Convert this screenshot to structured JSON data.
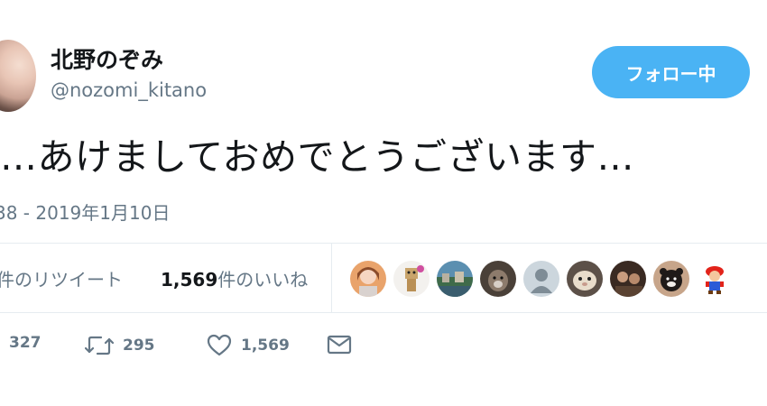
{
  "user": {
    "display_name": "北野のぞみ",
    "handle": "@nozomi_kitano"
  },
  "follow_button": {
    "label": "フォロー中",
    "color": "#4ab3f4"
  },
  "tweet": {
    "text": "…あけましておめでとうございます…",
    "timestamp": "38 - 2019年1月10日"
  },
  "stats": {
    "retweets_label": "件のリツイート",
    "likes_count": "1,569",
    "likes_label": "件のいいね"
  },
  "likers": [
    {
      "icon": "avatar-woman-icon"
    },
    {
      "icon": "avatar-danbo-icon"
    },
    {
      "icon": "avatar-landscape-icon"
    },
    {
      "icon": "avatar-dog-icon"
    },
    {
      "icon": "avatar-default-icon"
    },
    {
      "icon": "avatar-cat-icon"
    },
    {
      "icon": "avatar-person-icon"
    },
    {
      "icon": "avatar-bear-icon"
    },
    {
      "icon": "avatar-mario-icon"
    }
  ],
  "actions": {
    "replies": "327",
    "retweets": "295",
    "likes": "1,569"
  },
  "colors": {
    "text_primary": "#14171a",
    "text_secondary": "#657786",
    "divider": "#e6ecf0"
  }
}
